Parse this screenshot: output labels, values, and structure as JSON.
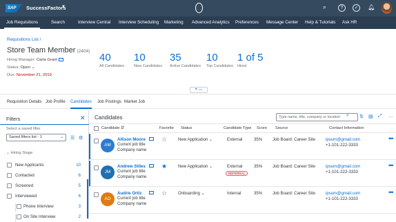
{
  "shell": {
    "brand": "SAP",
    "title": "SuccessFactors"
  },
  "nav": [
    "Job Requisitions",
    "Search",
    "Interview Central",
    "Interview Scheduling",
    "Marketing",
    "Advanced Analytics",
    "Preferences",
    "Message Center",
    "Help & Tutorials",
    "Ask HR"
  ],
  "header": {
    "breadcrumb": "Requisitions List /",
    "title": "Store Team Member",
    "title_id": "(2404)",
    "hiring_manager_label": "Hiring Manager:",
    "hiring_manager": "Carla Grant",
    "status_label": "Status:",
    "status": "Open",
    "due_label": "Due:",
    "due": "November 21, 2019",
    "kpis": [
      {
        "value": "40",
        "label": "All Candidates"
      },
      {
        "value": "10",
        "label": "New Candidates"
      },
      {
        "value": "35",
        "label": "Active Candidates"
      },
      {
        "value": "10",
        "label": "Top Candidates"
      },
      {
        "value": "1 of 5",
        "label": "Hired"
      }
    ]
  },
  "subtabs": [
    "Requisition Details",
    "Job Profile",
    "Candidates",
    "Job Postings",
    "Market Job"
  ],
  "filters": {
    "title": "Filters",
    "saved_label": "Select a saved filter",
    "saved_value": "Saved filters list - 1",
    "group": "Hiring Stage",
    "items": [
      {
        "label": "New Applicants",
        "count": "10"
      },
      {
        "label": "Contacted",
        "count": "6"
      },
      {
        "label": "Screened",
        "count": "5"
      },
      {
        "label": "Interviewed",
        "count": "6"
      },
      {
        "label": "Phone Interview",
        "count": "3"
      },
      {
        "label": "On Site Interview",
        "count": "2"
      }
    ]
  },
  "candidates": {
    "title": "Candidates",
    "search_placeholder": "Type name, title, company or location",
    "columns": [
      "Candidate",
      "Favorite",
      "Status",
      "Candidate Type",
      "Score",
      "Source",
      "Contact Information"
    ],
    "rows": [
      {
        "initials": "AM",
        "color": "#2b7cd3",
        "name": "Allison Moore",
        "title": "Current job title",
        "company": "Company name",
        "favorite": false,
        "status": "New Application",
        "type": "External",
        "badge": "",
        "score": "35%",
        "source": "Job Board: Career Site",
        "email": "ipsum@gmail.com",
        "phone": "+1-101-222-3333"
      },
      {
        "initials": "JM",
        "color": "#1f6fb2",
        "name": "Andrew Stiles",
        "title": "Current job title",
        "company": "Company name",
        "favorite": true,
        "status": "New Application",
        "type": "External",
        "badge": "REFERRAL",
        "score": "35%",
        "source": "Job Board: Career Site",
        "email": "ipsum@gmail.com",
        "phone": "+1-101-222-3333"
      },
      {
        "initials": "AO",
        "color": "#e07b12",
        "name": "Audrie Ortiz",
        "title": "Current job title",
        "company": "Company name",
        "favorite": false,
        "status": "Onboarding",
        "type": "Internal",
        "badge": "",
        "score": "35%",
        "source": "Job Board: Career Site",
        "email": "ipsum@gmail.com",
        "phone": "+1-101-222-3333"
      }
    ]
  }
}
